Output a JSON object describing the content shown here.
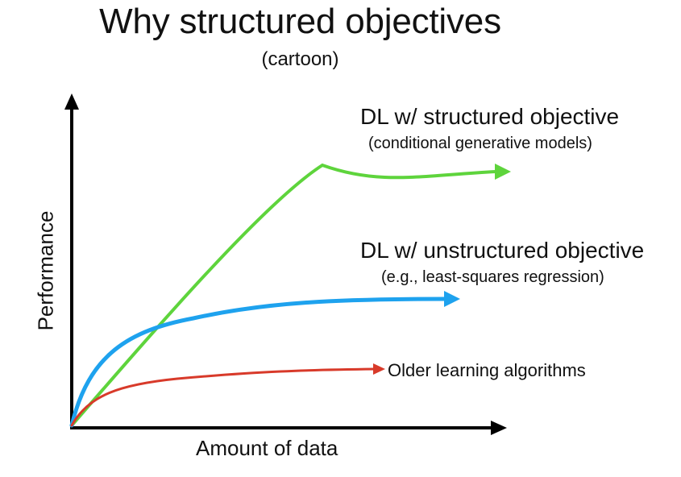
{
  "title": "Why structured objectives",
  "subtitle": "(cartoon)",
  "axes": {
    "x_label": "Amount of data",
    "y_label": "Performance"
  },
  "curves": [
    {
      "id": "green",
      "name": "DL w/ structured objective",
      "note": "(conditional generative models)",
      "color": "#5ed43c"
    },
    {
      "id": "blue",
      "name": "DL w/ unstructured objective",
      "note": "(e.g., least-squares regression)",
      "color": "#1ea2ee"
    },
    {
      "id": "red",
      "name": "Older learning algorithms",
      "color": "#d83a2a"
    }
  ],
  "axis_color": "#000000"
}
